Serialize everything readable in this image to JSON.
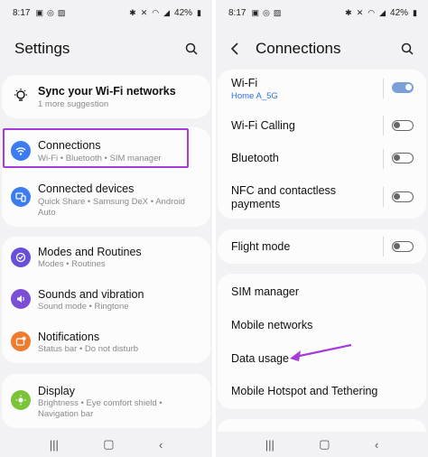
{
  "status": {
    "time": "8:17",
    "battery": "42%"
  },
  "left": {
    "title": "Settings",
    "suggestion": {
      "label": "Sync your Wi-Fi networks",
      "sub": "1 more suggestion"
    },
    "items": [
      {
        "label": "Connections",
        "sub": "Wi-Fi  •  Bluetooth  •  SIM manager",
        "icon": "wifi-icon",
        "color": "#3d7cf0"
      },
      {
        "label": "Connected devices",
        "sub": "Quick Share  •  Samsung DeX  •  Android",
        "sub2": "Auto",
        "icon": "connected-devices-icon",
        "color": "#3d7cf0"
      },
      {
        "label": "Modes and Routines",
        "sub": "Modes  •  Routines",
        "icon": "modes-icon",
        "color": "#6a4fd8"
      },
      {
        "label": "Sounds and vibration",
        "sub": "Sound mode  •  Ringtone",
        "icon": "sound-icon",
        "color": "#7a4fd6"
      },
      {
        "label": "Notifications",
        "sub": "Status bar  •  Do not disturb",
        "icon": "notifications-icon",
        "color": "#f07a2e"
      },
      {
        "label": "Display",
        "sub": "Brightness  •  Eye comfort shield  •",
        "sub2": "Navigation bar",
        "icon": "display-icon",
        "color": "#7bc43a"
      }
    ]
  },
  "right": {
    "title": "Connections",
    "wifi": {
      "label": "Wi-Fi",
      "sub": "Home A_5G",
      "on": true
    },
    "wifi_calling": {
      "label": "Wi-Fi Calling",
      "on": false
    },
    "bluetooth": {
      "label": "Bluetooth",
      "on": false
    },
    "nfc": {
      "label1": "NFC and contactless",
      "label2": "payments",
      "on": false
    },
    "flight": {
      "label": "Flight mode",
      "on": false
    },
    "links": [
      "SIM manager",
      "Mobile networks",
      "Data usage",
      "Mobile Hotspot and Tethering"
    ]
  },
  "colors": {
    "highlight": "#a63bd7",
    "accent": "#3d7cf0",
    "toggle_on": "#7b9fd8"
  }
}
